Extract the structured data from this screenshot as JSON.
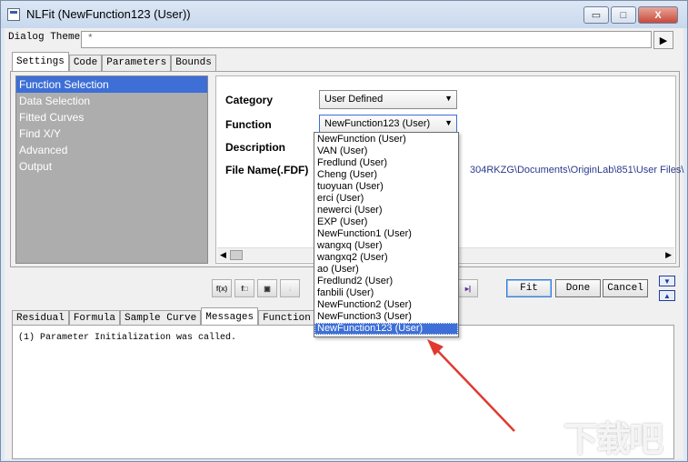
{
  "window": {
    "title": "NLFit (NewFunction123 (User))",
    "buttons": {
      "minimize": "▭",
      "maximize": "□",
      "close": "X"
    }
  },
  "dialog_theme": {
    "label": "Dialog Theme",
    "value": "*",
    "arrow": "▶"
  },
  "top_tabs": [
    "Settings",
    "Code",
    "Parameters",
    "Bounds"
  ],
  "nav": {
    "items": [
      "Function Selection",
      "Data Selection",
      "Fitted Curves",
      "Find X/Y",
      "Advanced",
      "Output"
    ],
    "selected_index": 0
  },
  "form": {
    "category_label": "Category",
    "category_value": "User Defined",
    "function_label": "Function",
    "function_value": "NewFunction123 (User)",
    "description_label": "Description",
    "filename_label": "File Name(.FDF)",
    "filename_value": "304RKZG\\Documents\\OriginLab\\851\\User Files\\"
  },
  "dropdown": {
    "items": [
      "NewFunction (User)",
      "VAN (User)",
      "Fredlund (User)",
      "Cheng (User)",
      "tuoyuan (User)",
      "erci (User)",
      "newerci (User)",
      "EXP (User)",
      "NewFunction1 (User)",
      "wangxq (User)",
      "wangxq2 (User)",
      "ao (User)",
      "Fredlund2 (User)",
      "fanbili (User)",
      "NewFunction2 (User)",
      "NewFunction3 (User)",
      "NewFunction123 (User)"
    ],
    "selected_index": 16
  },
  "toolbar": {
    "fit": "Fit",
    "done": "Done",
    "cancel": "Cancel"
  },
  "bottom_tabs": [
    "Residual",
    "Formula",
    "Sample Curve",
    "Messages",
    "Function Fil"
  ],
  "messages": [
    "(1) Parameter Initialization was called."
  ],
  "colors": {
    "selection": "#3d6fd6",
    "annotation_arrow": "#e03a30"
  }
}
